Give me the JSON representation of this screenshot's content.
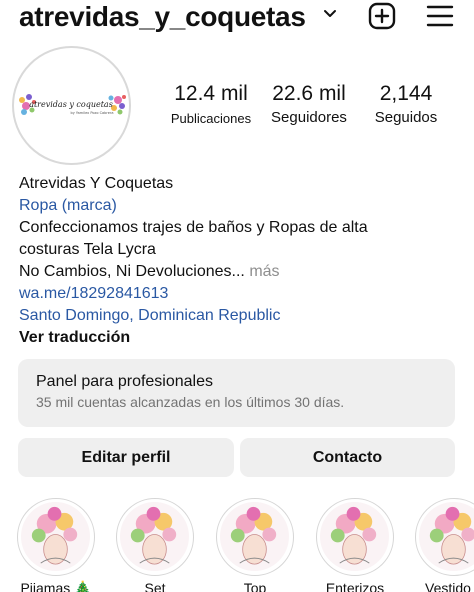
{
  "header": {
    "username": "atrevidas_y_coquetas"
  },
  "avatar": {
    "logo_text": "atrevidas y coquetas",
    "tagline": "by Yamilex Pozo Cabrera"
  },
  "stats": {
    "posts": {
      "value": "12.4 mil",
      "label": "Publicaciones"
    },
    "followers": {
      "value": "22.6 mil",
      "label": "Seguidores"
    },
    "following": {
      "value": "2,144",
      "label": "Seguidos"
    }
  },
  "bio": {
    "name": "Atrevidas Y Coquetas",
    "category": "Ropa (marca)",
    "line1": "Confeccionamos trajes de baños y Ropas de alta",
    "line2": "costuras Tela Lycra",
    "line3": "No Cambios, Ni Devoluciones...",
    "more": "más",
    "link": "wa.me/18292841613",
    "location": "Santo Domingo, Dominican Republic",
    "translate": "Ver traducción"
  },
  "panel": {
    "title": "Panel para profesionales",
    "subtitle": "35 mil cuentas alcanzadas en los últimos 30 días."
  },
  "buttons": {
    "edit": "Editar perfil",
    "contact": "Contacto"
  },
  "highlights": [
    {
      "label": "Pijamas 🎄"
    },
    {
      "label": "Set"
    },
    {
      "label": "Top"
    },
    {
      "label": "Enterizos"
    },
    {
      "label": "Vestido"
    }
  ],
  "colors": {
    "link_blue": "#2a58a3",
    "button_bg": "#efefef",
    "muted_text": "#737373"
  }
}
